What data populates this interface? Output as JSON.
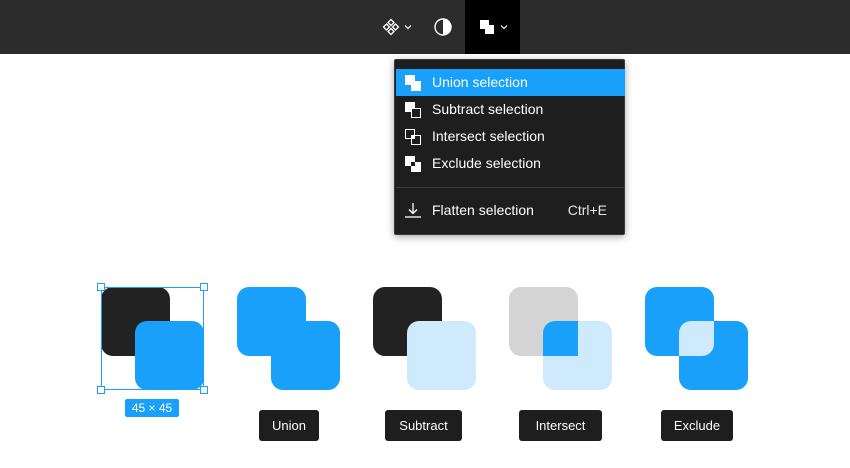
{
  "toolbar": {
    "buttons": [
      {
        "icon": "components-icon",
        "has_dropdown": true
      },
      {
        "icon": "contrast-icon",
        "has_dropdown": false
      },
      {
        "icon": "boolean-union-icon",
        "has_dropdown": true,
        "active": true
      }
    ]
  },
  "menu": {
    "items": [
      {
        "label": "Union selection",
        "icon": "union-icon",
        "active": true
      },
      {
        "label": "Subtract selection",
        "icon": "subtract-icon"
      },
      {
        "label": "Intersect selection",
        "icon": "intersect-icon"
      },
      {
        "label": "Exclude selection",
        "icon": "exclude-icon"
      }
    ],
    "flatten": {
      "label": "Flatten selection",
      "shortcut": "Ctrl+E",
      "icon": "flatten-icon"
    }
  },
  "canvas": {
    "selection_size": "45 × 45",
    "operations": [
      {
        "label": "Union"
      },
      {
        "label": "Subtract"
      },
      {
        "label": "Intersect"
      },
      {
        "label": "Exclude"
      }
    ]
  },
  "colors": {
    "toolbar_bg": "#2c2c2c",
    "menu_bg": "#1e1e1e",
    "accent": "#18a0fb",
    "dark_shape": "#222222",
    "light_blue": "#cfe9fd",
    "gray_shape": "#d4d4d4"
  }
}
